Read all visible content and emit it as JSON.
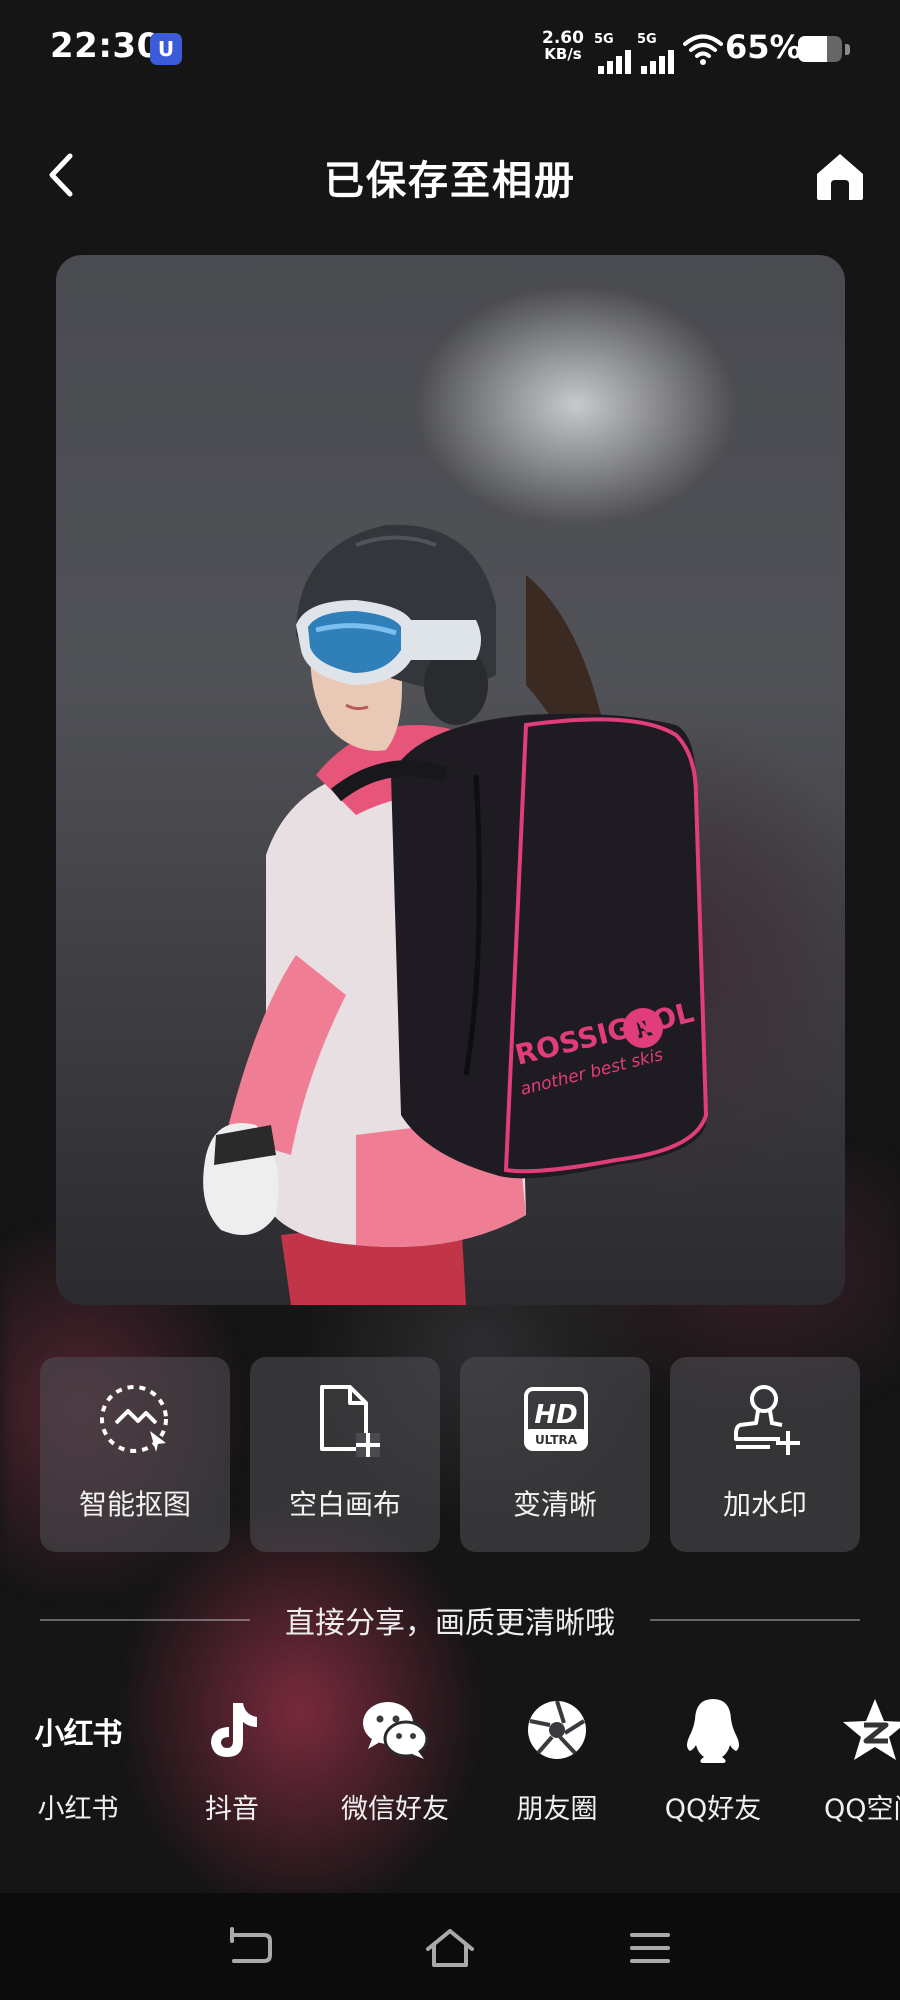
{
  "status": {
    "time": "22:30",
    "app_badge": "U",
    "net_speed_value": "2.60",
    "net_speed_unit": "KB/s",
    "sim1": "5G",
    "sim2": "5G",
    "battery_pct": "65%",
    "battery_level": 0.65
  },
  "header": {
    "title": "已保存至相册",
    "back_icon": "chevron-left-icon",
    "home_icon": "home-icon"
  },
  "photo": {
    "subject": "skier-with-backpack",
    "backpack_brand": "ROSSIGNOL",
    "backpack_tagline": "another best skis",
    "backpack_logo_letter": "R"
  },
  "tools": [
    {
      "label": "智能抠图",
      "icon": "smart-cutout-icon"
    },
    {
      "label": "空白画布",
      "icon": "blank-canvas-icon"
    },
    {
      "label": "变清晰",
      "icon": "hd-ultra-icon",
      "icon_text_top": "HD",
      "icon_text_bottom": "ULTRA"
    },
    {
      "label": "加水印",
      "icon": "watermark-stamp-icon"
    }
  ],
  "share": {
    "title": "直接分享，画质更清晰哦",
    "targets": [
      {
        "label": "小红书",
        "icon": "xiaohongshu-icon",
        "logo_text": "小红书"
      },
      {
        "label": "抖音",
        "icon": "douyin-icon"
      },
      {
        "label": "微信好友",
        "icon": "wechat-icon"
      },
      {
        "label": "朋友圈",
        "icon": "moments-icon"
      },
      {
        "label": "QQ好友",
        "icon": "qq-icon"
      },
      {
        "label": "QQ空间",
        "icon": "qzone-icon"
      }
    ]
  },
  "navbar": {
    "back": "nav-back-icon",
    "home": "nav-home-icon",
    "menu": "nav-menu-icon"
  }
}
